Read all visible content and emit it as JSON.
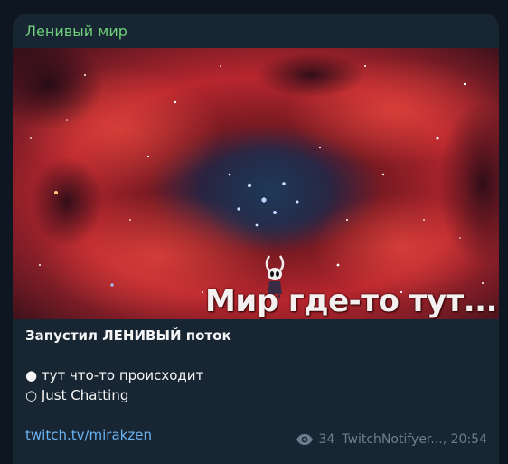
{
  "message": {
    "channel_name": "Ленивый мир",
    "photo": {
      "caption_text": "Мир где-то тут...",
      "icon": "rosette-nebula-image"
    },
    "text": {
      "headline": "Запустил ЛЕНИВЫЙ поток",
      "bullet_1": "● тут что-то происходит",
      "bullet_2": "○ Just Chatting"
    },
    "link": "twitch.tv/mirakzen",
    "meta": {
      "views_icon": "eye-icon",
      "views": "34",
      "author_time": "TwitchNotifyer..., 20:54"
    }
  },
  "colors": {
    "background": "#0e1621",
    "bubble": "#182533",
    "channel_name": "#6ed07a",
    "link": "#6ab3f3",
    "meta": "#6d7f8f"
  }
}
